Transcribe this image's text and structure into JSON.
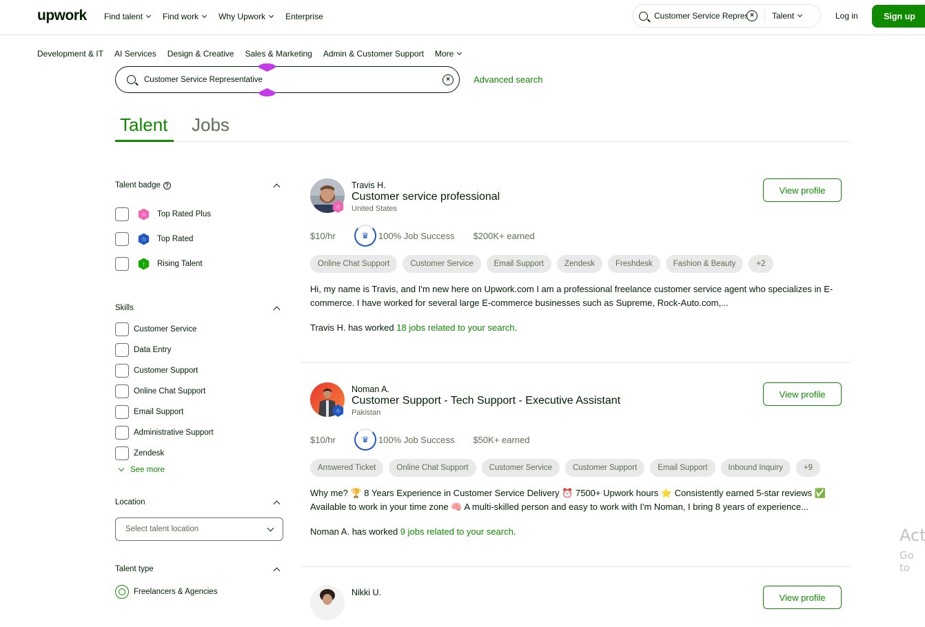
{
  "header": {
    "logo": "upwork",
    "nav": [
      {
        "label": "Find talent",
        "has_dropdown": true
      },
      {
        "label": "Find work",
        "has_dropdown": true
      },
      {
        "label": "Why Upwork",
        "has_dropdown": true
      },
      {
        "label": "Enterprise",
        "has_dropdown": false
      }
    ],
    "search": {
      "value": "Customer Service Repres",
      "scope": "Talent"
    },
    "login_label": "Log in",
    "signup_label": "Sign up",
    "accent_color": "#108a00"
  },
  "categories": [
    {
      "label": "Development & IT"
    },
    {
      "label": "AI Services"
    },
    {
      "label": "Design & Creative"
    },
    {
      "label": "Sales & Marketing"
    },
    {
      "label": "Admin & Customer Support"
    },
    {
      "label": "More"
    }
  ],
  "search": {
    "value": "Customer Service Representative",
    "advanced_label": "Advanced search"
  },
  "tabs": [
    {
      "label": "Talent",
      "active": true
    },
    {
      "label": "Jobs",
      "active": false
    }
  ],
  "filters": {
    "talent_badge": {
      "title": "Talent badge",
      "help_icon": "?",
      "options": [
        {
          "label": "Top Rated Plus",
          "color": "#f065b4",
          "icon": "star",
          "checked": false
        },
        {
          "label": "Top Rated",
          "color": "#1f57c3",
          "icon": "star",
          "checked": false
        },
        {
          "label": "Rising Talent",
          "color": "#14a800",
          "icon": "arrow-up",
          "checked": false
        }
      ]
    },
    "skills": {
      "title": "Skills",
      "options": [
        {
          "label": "Customer Service",
          "checked": false
        },
        {
          "label": "Data Entry",
          "checked": false
        },
        {
          "label": "Customer Support",
          "checked": false
        },
        {
          "label": "Online Chat Support",
          "checked": false
        },
        {
          "label": "Email Support",
          "checked": false
        },
        {
          "label": "Administrative Support",
          "checked": false
        },
        {
          "label": "Zendesk",
          "checked": false
        }
      ],
      "see_more_label": "See more"
    },
    "location": {
      "title": "Location",
      "placeholder": "Select talent location"
    },
    "talent_type": {
      "title": "Talent type",
      "options": [
        {
          "label": "Freelancers & Agencies",
          "selected": true
        }
      ]
    }
  },
  "results": [
    {
      "name": "Travis H.",
      "title": "Customer service professional",
      "country": "United States",
      "badge": "Top Rated Plus",
      "badge_color": "#f065b4",
      "rate": "$10/hr",
      "job_success": "100% Job Success",
      "earned": "$200K+ earned",
      "skills": [
        "Online Chat Support",
        "Customer Service",
        "Email Support",
        "Zendesk",
        "Freshdesk",
        "Fashion & Beauty",
        "+2"
      ],
      "description": "Hi, my name is Travis, and I'm new here on Upwork.com I am a professional freelance customer service agent who specializes in E-commerce. I have worked for several large E-commerce businesses such as Supreme, Rock-Auto.com,...",
      "worked_prefix": "Travis H. has worked ",
      "worked_link": "18 jobs related to your search",
      "worked_suffix": ".",
      "view_label": "View profile"
    },
    {
      "name": "Noman A.",
      "title": "Customer Support - Tech Support - Executive Assistant",
      "country": "Pakistan",
      "badge": "Top Rated",
      "badge_color": "#1f57c3",
      "rate": "$10/hr",
      "job_success": "100% Job Success",
      "earned": "$50K+ earned",
      "skills": [
        "Answered Ticket",
        "Online Chat Support",
        "Customer Service",
        "Customer Support",
        "Email Support",
        "Inbound Inquiry",
        "+9"
      ],
      "description": "Why me? 🏆 8 Years Experience in Customer Service Delivery ⏰ 7500+ Upwork hours ⭐ Consistently earned 5-star reviews ✅ Available to work in your time zone 🧠 A multi-skilled person and easy to work with I'm Noman, I bring 8 years of experience...",
      "worked_prefix": "Noman A. has worked ",
      "worked_link": "9 jobs related to your search",
      "worked_suffix": ".",
      "view_label": "View profile"
    },
    {
      "name": "Nikki U.",
      "view_label": "View profile"
    }
  ],
  "os_overlay": {
    "line1": "Act",
    "line2": "Go to"
  }
}
